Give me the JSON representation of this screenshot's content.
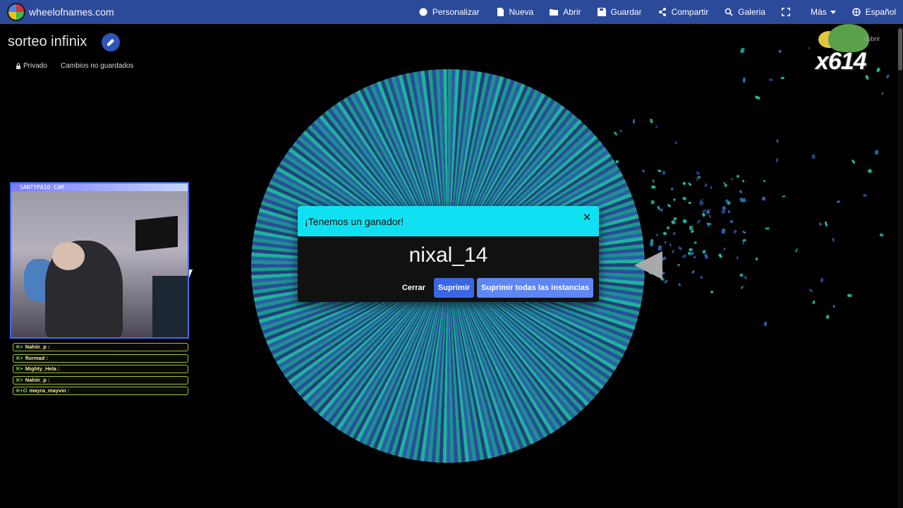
{
  "app": {
    "name": "wheelofnames.com"
  },
  "menu": [
    {
      "label": "Personalizar",
      "icon": "palette-icon"
    },
    {
      "label": "Nueva",
      "icon": "file-icon"
    },
    {
      "label": "Abrir",
      "icon": "folder-icon"
    },
    {
      "label": "Guardar",
      "icon": "save-icon"
    },
    {
      "label": "Compartir",
      "icon": "share-icon"
    },
    {
      "label": "Galeria",
      "icon": "search-icon"
    },
    {
      "label": "",
      "icon": "fullscreen-icon"
    },
    {
      "label": "Más",
      "icon": "caret-down-icon"
    },
    {
      "label": "Español",
      "icon": "globe-icon"
    }
  ],
  "wheel": {
    "title": "sorteo infinix",
    "privacy": "Privado",
    "save_state": "Cambios no guardados"
  },
  "camera": {
    "label": "SANTYPA10 CAM"
  },
  "chat": [
    {
      "badges": "K+",
      "user": "Nahiir_p :"
    },
    {
      "badges": "K+",
      "user": "flormad :"
    },
    {
      "badges": "K+",
      "user": "Mighty_Hela :"
    },
    {
      "badges": "K+",
      "user": "Nahiir_p :"
    },
    {
      "badges": "K+O",
      "user": "mayra_mayvin :"
    }
  ],
  "stream_badge": {
    "count": "x614",
    "side_text": "cubrir"
  },
  "dialog": {
    "title": "¡Tenemos un ganador!",
    "winner": "nixal_14",
    "close_label": "Cerrar",
    "remove_label": "Suprimir",
    "remove_all_label": "Suprimir todas las instancias"
  },
  "colors": {
    "topbar": "#2b4a9a",
    "dialog_header": "#10e1f2",
    "primary_button": "#5f86f3"
  }
}
